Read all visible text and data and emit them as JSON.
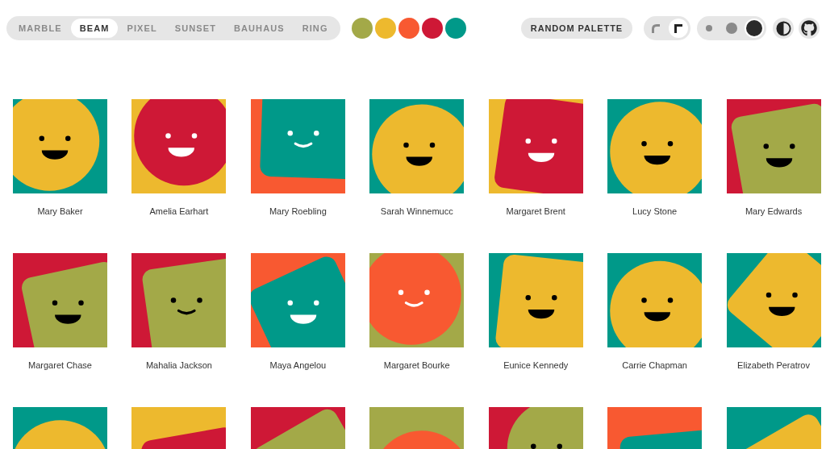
{
  "variants": [
    {
      "label": "MARBLE",
      "selected": false
    },
    {
      "label": "BEAM",
      "selected": true
    },
    {
      "label": "PIXEL",
      "selected": false
    },
    {
      "label": "SUNSET",
      "selected": false
    },
    {
      "label": "BAUHAUS",
      "selected": false
    },
    {
      "label": "RING",
      "selected": false
    }
  ],
  "palette": [
    {
      "color": "#a3a948"
    },
    {
      "color": "#edb92e"
    },
    {
      "color": "#f85931"
    },
    {
      "color": "#ce1836"
    },
    {
      "color": "#009989"
    }
  ],
  "random_button": {
    "label": "RANDOM PALETTE"
  },
  "corner_toggle": [
    {
      "kind": "round",
      "selected": false
    },
    {
      "kind": "square",
      "selected": true
    }
  ],
  "size_toggle": [
    {
      "kind": "small",
      "selected": false
    },
    {
      "kind": "medium",
      "selected": false
    },
    {
      "kind": "large",
      "selected": true
    }
  ],
  "avatars": [
    {
      "name": "Mary Baker",
      "kind": "beam"
    },
    {
      "name": "Amelia Earhart",
      "kind": "beam"
    },
    {
      "name": "Mary Roebling",
      "kind": "beam"
    },
    {
      "name": "Sarah Winnemucc",
      "kind": "beam"
    },
    {
      "name": "Margaret Brent",
      "kind": "beam"
    },
    {
      "name": "Lucy Stone",
      "kind": "beam"
    },
    {
      "name": "Mary Edwards",
      "kind": "beam"
    },
    {
      "name": "Margaret Chase",
      "kind": "beam"
    },
    {
      "name": "Mahalia Jackson",
      "kind": "beam"
    },
    {
      "name": "Maya Angelou",
      "kind": "beam"
    },
    {
      "name": "Margaret Bourke",
      "kind": "beam"
    },
    {
      "name": "Eunice Kennedy",
      "kind": "beam"
    },
    {
      "name": "Carrie Chapman",
      "kind": "beam"
    },
    {
      "name": "Elizabeth Peratrov",
      "kind": "beam"
    },
    {
      "kind": "beam"
    },
    {
      "kind": "beam"
    },
    {
      "kind": "beam"
    },
    {
      "kind": "beam"
    },
    {
      "kind": "beam"
    },
    {
      "kind": "beam"
    },
    {
      "kind": "beam"
    }
  ]
}
